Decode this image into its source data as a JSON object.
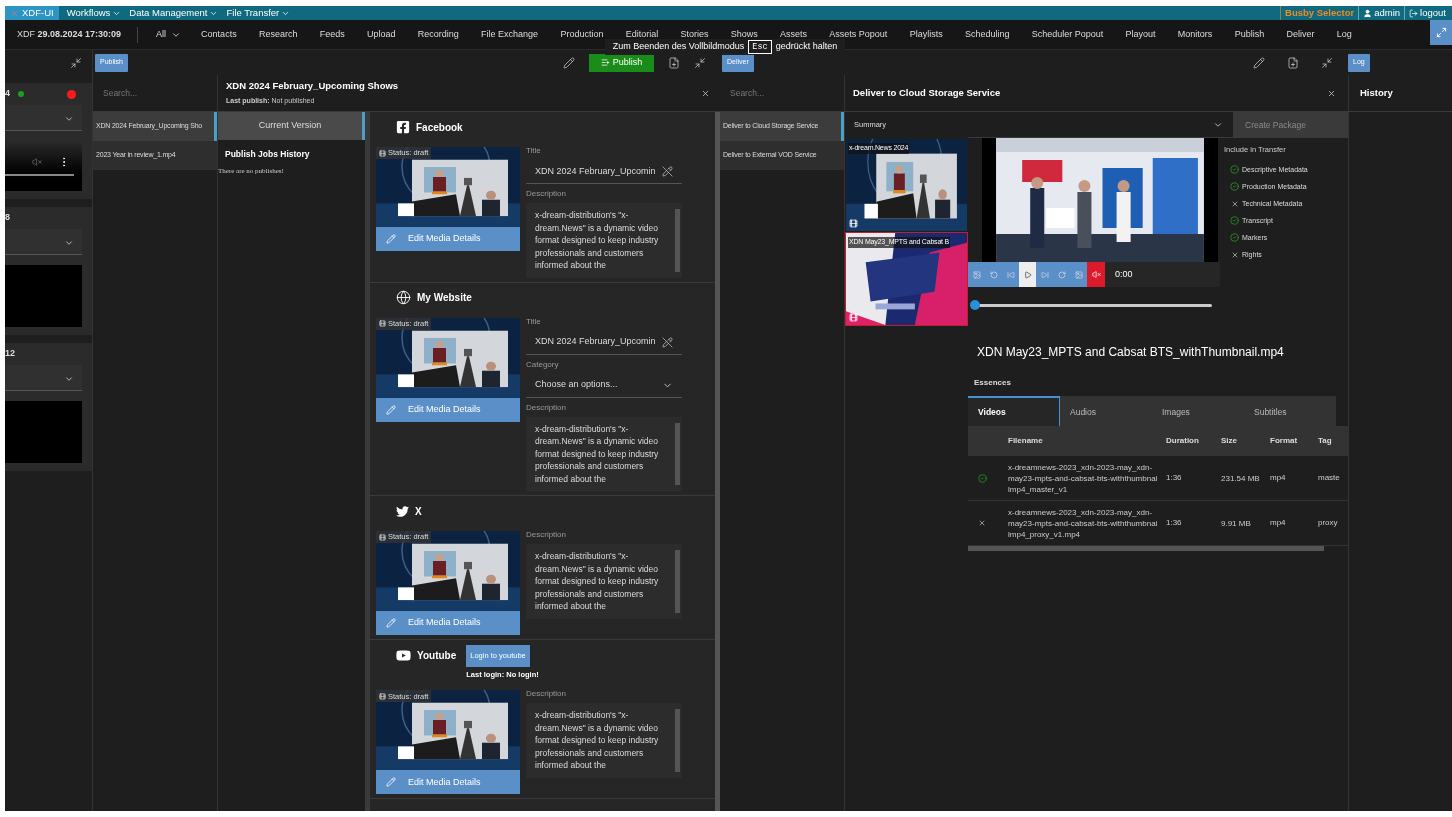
{
  "topbar": {
    "logo": "XDF-UI",
    "menus": [
      "Workflows",
      "Data Management",
      "File Transfer"
    ],
    "selector": "Busby Selector",
    "user": "admin",
    "logout": "logout"
  },
  "nav": {
    "clock_prefix": "XDF",
    "clock": "29.08.2024 17:30:09",
    "filter": "All",
    "items": [
      "Contacts",
      "Research",
      "Feeds",
      "Upload",
      "Recording",
      "File Exchange",
      "Production",
      "Editorial",
      "Stories",
      "Shows",
      "Assets",
      "Assets Popout",
      "Playlists",
      "Scheduling",
      "Scheduler Popout",
      "Playout",
      "Monitors",
      "Publish",
      "Deliver",
      "Log"
    ]
  },
  "fullscreen_notice": {
    "before": "Zum Beenden des Vollbildmodus",
    "key": "Esc",
    "after": "gedrückt halten"
  },
  "monitors": [
    {
      "label": "4",
      "kind": "live",
      "level": 1,
      "indicators": [
        {
          "color": "#1f9e1f"
        },
        {
          "color": "#ff1a1a"
        }
      ]
    },
    {
      "label": "8",
      "kind": "idle"
    },
    {
      "label": "12",
      "kind": "idle"
    }
  ],
  "publish": {
    "tag": "Publish",
    "action": "Publish",
    "search_placeholder": "Search...",
    "items": [
      {
        "label": "XDN 2024 February_Upcoming Sho",
        "selected": true
      },
      {
        "label": "2023 Year in review_1.mp4",
        "selected": false
      }
    ],
    "title": "XDN 2024 February_Upcoming Shows",
    "last_publish_label": "Last publish:",
    "last_publish": "Not published",
    "version_tab": "Current Version",
    "history_title": "Publish Jobs History",
    "history_empty": "There are no publishes!",
    "channels": [
      {
        "kind": "facebook",
        "name": "Facebook",
        "status": "Status: draft",
        "edit": "Edit Media Details",
        "fields": [
          {
            "kind": "text",
            "label": "Title",
            "value": "XDN 2024 February_Upcomin"
          },
          {
            "kind": "textarea",
            "label": "Description",
            "value": "x-dream-distribution's \"x-dream.News\" is a dynamic video format designed to keep industry professionals and customers informed about the"
          }
        ]
      },
      {
        "kind": "website",
        "name": "My Website",
        "status": "Status: draft",
        "edit": "Edit Media Details",
        "fields": [
          {
            "kind": "text",
            "label": "Title",
            "value": "XDN 2024 February_Upcomin"
          },
          {
            "kind": "select",
            "label": "Category",
            "placeholder": "Choose an options..."
          },
          {
            "kind": "textarea",
            "label": "Description",
            "value": "x-dream-distribution's \"x-dream.News\" is a dynamic video format designed to keep industry professionals and customers informed about the"
          }
        ]
      },
      {
        "kind": "x",
        "name": "X",
        "status": "Status: draft",
        "edit": "Edit Media Details",
        "fields": [
          {
            "kind": "textarea",
            "label": "Description",
            "value": "x-dream-distribution's \"x-dream.News\" is a dynamic video format designed to keep industry professionals and customers informed about the"
          }
        ]
      },
      {
        "kind": "youtube",
        "name": "Youtube",
        "login": {
          "button": "Login to youtube",
          "label": "Last login:",
          "value": "No login!"
        },
        "status": "Status: draft",
        "edit": "Edit Media Details",
        "fields": [
          {
            "kind": "textarea",
            "label": "Description",
            "value": "x-dream-distribution's \"x-dream.News\" is a dynamic video format designed to keep industry professionals and customers informed about the"
          }
        ]
      }
    ]
  },
  "deliver": {
    "tag": "Deliver",
    "search_placeholder": "Search...",
    "items": [
      {
        "label": "Deliver to Cloud Storage Service",
        "selected": true
      },
      {
        "label": "Deliver to External VOD Service",
        "selected": false
      }
    ],
    "title": "Deliver to Cloud Storage Service",
    "summary": "Summary",
    "assets": [
      {
        "label": "x-dream.News 2024",
        "kind": "studio",
        "selected": false
      },
      {
        "label": "XDN May23_MPTS and Cabsat B",
        "kind": "show",
        "selected": true
      }
    ],
    "create_package": {
      "label": "Create Package",
      "disabled": true
    },
    "player": {
      "time": "0:00",
      "muted": true,
      "level": 0
    },
    "include_title": "Include in Transfer",
    "include": [
      {
        "label": "Descriptive Metadata",
        "checked": true
      },
      {
        "label": "Production Metadata",
        "checked": true
      },
      {
        "label": "Technical Metadata",
        "checked": false
      },
      {
        "label": "Transcript",
        "checked": true
      },
      {
        "label": "Markers",
        "checked": true
      },
      {
        "label": "Rights",
        "checked": false
      }
    ],
    "filename": "XDN May23_MPTS and Cabsat BTS_withThumbnail.mp4",
    "essences_title": "Essences",
    "tabs": [
      {
        "label": "Videos",
        "selected": true
      },
      {
        "label": "Audios",
        "selected": false
      },
      {
        "label": "Images",
        "selected": false
      },
      {
        "label": "Subtitles",
        "selected": false
      }
    ],
    "table": {
      "columns": [
        "Filename",
        "Duration",
        "Size",
        "Format",
        "Tag"
      ],
      "rows": [
        {
          "checked": true,
          "cells": [
            "x-dreamnews-2023_xdn-2023-may_xdn-may23-mpts-and-cabsat-bts-withthumbnailmp4_master_v1",
            "1:36",
            "231.54 MB",
            "mp4",
            "maste"
          ]
        },
        {
          "checked": false,
          "cells": [
            "x-dreamnews-2023_xdn-2023-may_xdn-may23-mpts-and-cabsat-bts-withthumbnailmp4_proxy_v1.mp4",
            "1:36",
            "9.91 MB",
            "mp4",
            "proxy"
          ]
        }
      ]
    }
  },
  "history": {
    "tag": "Log",
    "title": "History"
  }
}
